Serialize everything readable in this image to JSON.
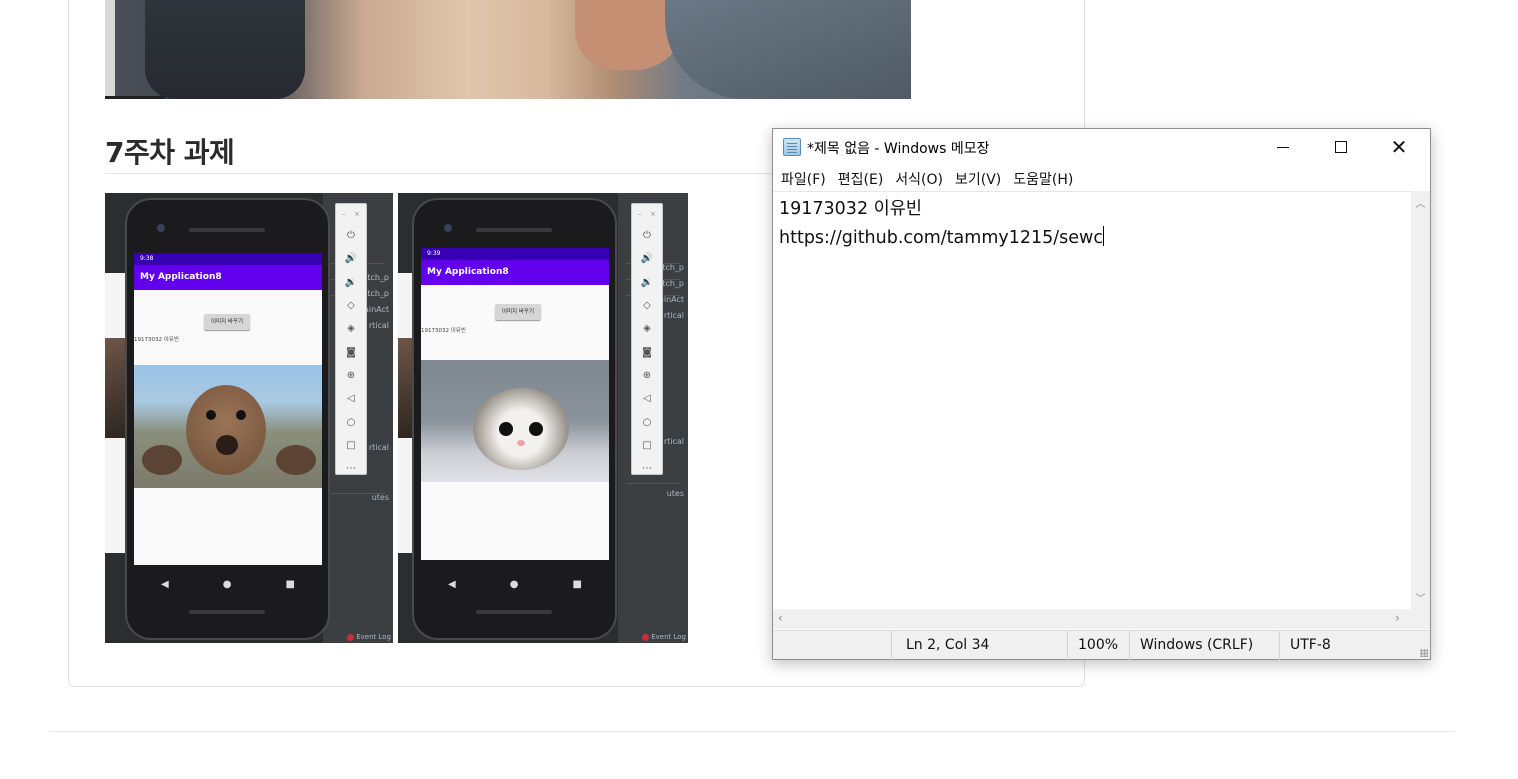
{
  "blog": {
    "section_title": "7주차 과제"
  },
  "phone_left": {
    "status_time": "9:38",
    "app_title": "My Application8",
    "button_label": "이미지 바꾸기",
    "student_text": "19173032 이유빈",
    "event_log": "Event Log"
  },
  "phone_right": {
    "status_time": "9:39",
    "app_title": "My Application8",
    "button_label": "이미지 바꾸기",
    "student_text": "19173032 이유빈",
    "event_log": "Event Log"
  },
  "ide_labels": [
    "atch_p",
    "atch_p",
    "ainAct",
    "rtical",
    "rtical",
    "utes"
  ],
  "notepad": {
    "title": "*제목 없음 - Windows 메모장",
    "menus": [
      "파일(F)",
      "편집(E)",
      "서식(O)",
      "보기(V)",
      "도움말(H)"
    ],
    "line1": "19173032 이유빈",
    "line2": "https://github.com/tammy1215/sewc",
    "status": {
      "position": "Ln 2, Col 34",
      "zoom": "100%",
      "line_ending": "Windows (CRLF)",
      "encoding": "UTF-8"
    }
  },
  "colors": {
    "app_bar": "#6200ee",
    "status_bar": "#3700b3",
    "notepad_chrome": "#f0f0f0"
  }
}
